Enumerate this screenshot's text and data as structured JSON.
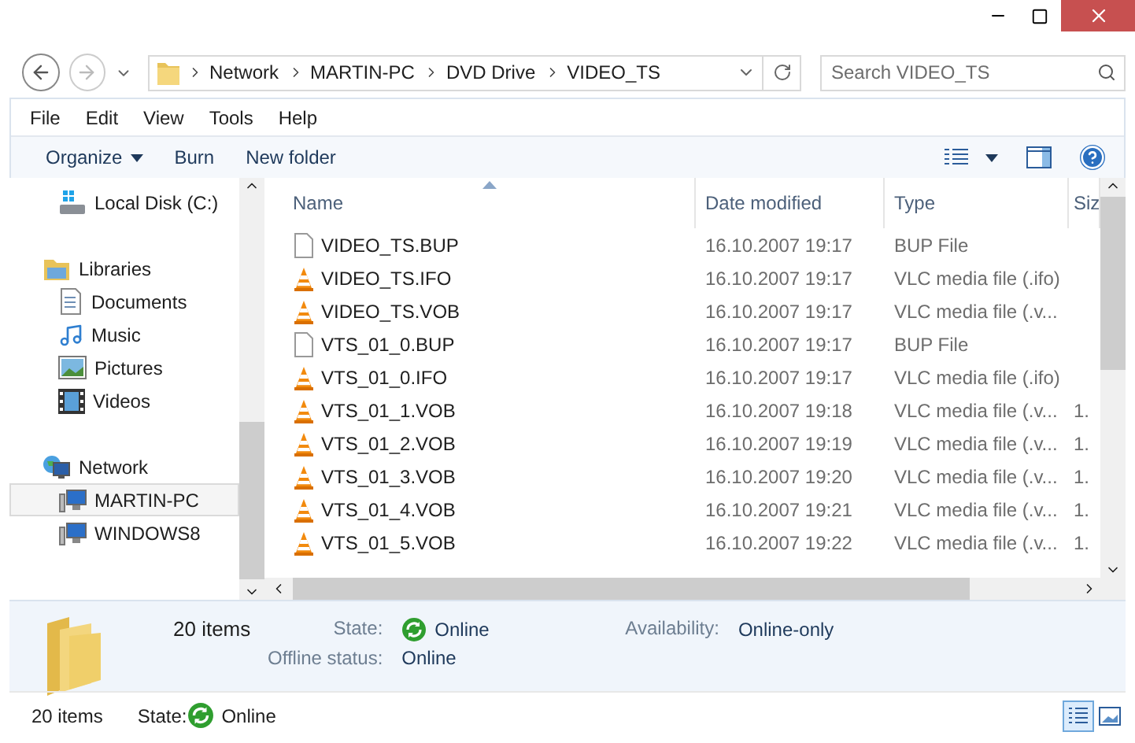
{
  "nav_buttons": [
    {
      "kind": "back",
      "disabled": false
    },
    {
      "kind": "forward",
      "disabled": true
    }
  ],
  "address": {
    "breadcrumbs": [
      "Network",
      "MARTIN-PC",
      "DVD Drive",
      "VIDEO_TS"
    ]
  },
  "search": {
    "placeholder": "Search VIDEO_TS"
  },
  "menu": [
    "File",
    "Edit",
    "View",
    "Tools",
    "Help"
  ],
  "toolbar": [
    {
      "label": "Organize",
      "dropdown": true
    },
    {
      "label": "Burn",
      "dropdown": false
    },
    {
      "label": "New folder",
      "dropdown": false
    }
  ],
  "sidebar": {
    "items": [
      {
        "kind": "drive",
        "label": "Local Disk (C:)",
        "selected": false
      },
      {
        "kind": "library",
        "label": "Libraries",
        "selected": false,
        "children": [
          {
            "kind": "documents",
            "label": "Documents",
            "selected": false
          },
          {
            "kind": "music",
            "label": "Music",
            "selected": false
          },
          {
            "kind": "pictures",
            "label": "Pictures",
            "selected": false
          },
          {
            "kind": "videos",
            "label": "Videos",
            "selected": false
          }
        ]
      },
      {
        "kind": "network",
        "label": "Network",
        "selected": false,
        "children": [
          {
            "kind": "computer",
            "label": "MARTIN-PC",
            "selected": true
          },
          {
            "kind": "computer",
            "label": "WINDOWS8",
            "selected": false
          }
        ]
      }
    ]
  },
  "table": {
    "columns": [
      {
        "label": "Name",
        "sorted": true
      },
      {
        "label": "Date modified",
        "sorted": false
      },
      {
        "label": "Type",
        "sorted": false
      },
      {
        "label": "Siz",
        "sorted": false
      }
    ],
    "rows": [
      {
        "kind": "file",
        "name": "VIDEO_TS.BUP",
        "date": "16.10.2007 19:17",
        "type": "BUP File",
        "size": ""
      },
      {
        "kind": "vlc",
        "name": "VIDEO_TS.IFO",
        "date": "16.10.2007 19:17",
        "type": "VLC media file (.ifo)",
        "size": ""
      },
      {
        "kind": "vlc",
        "name": "VIDEO_TS.VOB",
        "date": "16.10.2007 19:17",
        "type": "VLC media file (.v...",
        "size": ""
      },
      {
        "kind": "file",
        "name": "VTS_01_0.BUP",
        "date": "16.10.2007 19:17",
        "type": "BUP File",
        "size": ""
      },
      {
        "kind": "vlc",
        "name": "VTS_01_0.IFO",
        "date": "16.10.2007 19:17",
        "type": "VLC media file (.ifo)",
        "size": ""
      },
      {
        "kind": "vlc",
        "name": "VTS_01_1.VOB",
        "date": "16.10.2007 19:18",
        "type": "VLC media file (.v...",
        "size": "1."
      },
      {
        "kind": "vlc",
        "name": "VTS_01_2.VOB",
        "date": "16.10.2007 19:19",
        "type": "VLC media file (.v...",
        "size": "1."
      },
      {
        "kind": "vlc",
        "name": "VTS_01_3.VOB",
        "date": "16.10.2007 19:20",
        "type": "VLC media file (.v...",
        "size": "1."
      },
      {
        "kind": "vlc",
        "name": "VTS_01_4.VOB",
        "date": "16.10.2007 19:21",
        "type": "VLC media file (.v...",
        "size": "1."
      },
      {
        "kind": "vlc",
        "name": "VTS_01_5.VOB",
        "date": "16.10.2007 19:22",
        "type": "VLC media file (.v...",
        "size": "1."
      }
    ]
  },
  "details": {
    "count": "20 items",
    "fields": [
      {
        "label": "State:",
        "value": "Online",
        "icon": true
      },
      {
        "label": "Availability:",
        "value": "Online-only",
        "icon": false
      },
      {
        "label": "Offline status:",
        "value": "Online",
        "icon": false
      }
    ]
  },
  "status_bar": {
    "count": "20 items",
    "state_label": "State:",
    "state_value": "Online",
    "views": [
      {
        "kind": "details",
        "selected": true
      },
      {
        "kind": "large-icons",
        "selected": false
      }
    ]
  }
}
